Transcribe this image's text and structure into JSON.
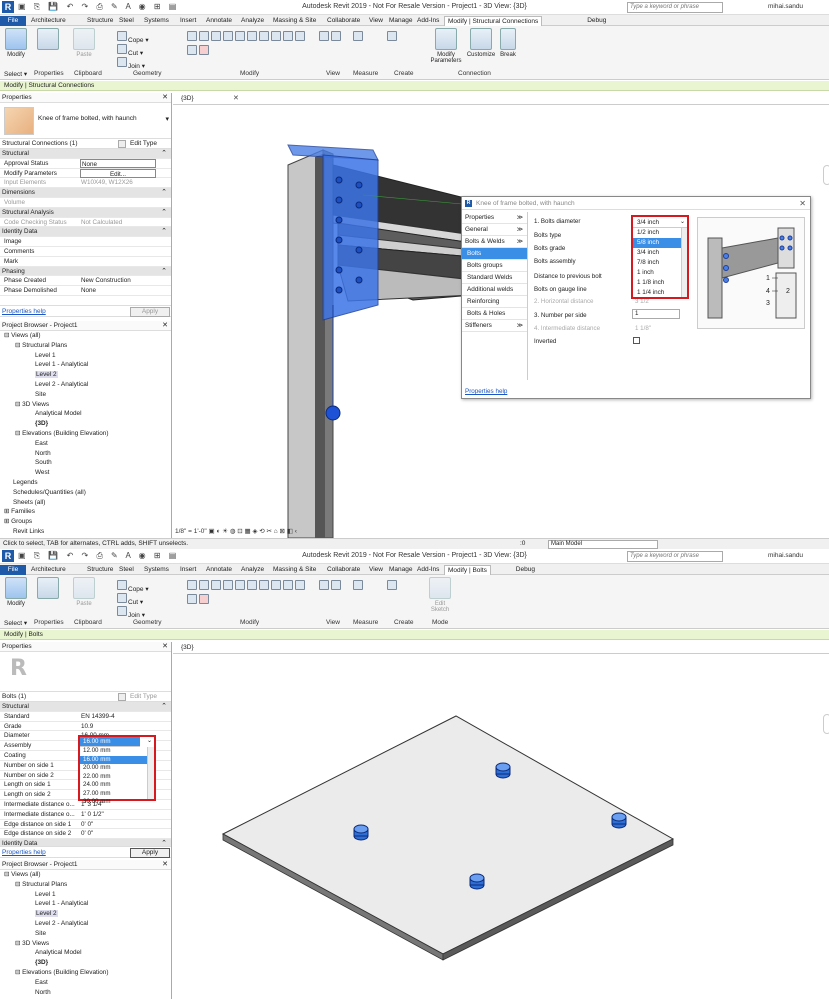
{
  "top": {
    "window_title": "Autodesk Revit 2019 - Not For Resale Version - Project1 - 3D View: {3D}",
    "search_placeholder": "Type a keyword or phrase",
    "user": "mihai.sandu",
    "tabs": [
      "File",
      "Architecture",
      "Structure",
      "Steel",
      "Systems",
      "Insert",
      "Annotate",
      "Analyze",
      "Massing & Site",
      "Collaborate",
      "View",
      "Manage",
      "Add-Ins",
      "Modify | Structural Connections",
      "Debug"
    ],
    "ribbon": {
      "modify": "Modify",
      "select": "Select ▾",
      "properties": "Properties",
      "clipboard": "Clipboard",
      "paste": "Paste",
      "cope": "Cope",
      "cut": "Cut",
      "join": "Join",
      "geometry": "Geometry",
      "modify_panel": "Modify",
      "view": "View",
      "measure": "Measure",
      "create": "Create",
      "modify_parameters": "Modify Parameters",
      "customize": "Customize",
      "break": "Break",
      "connection": "Connection"
    },
    "context": "Modify | Structural Connections",
    "properties_title": "Properties",
    "type_name": "Knee of frame bolted, with haunch",
    "filter": "Structural Connections (1)",
    "edit_type": "Edit Type",
    "properties": [
      {
        "k": "Structural",
        "v": "",
        "cat": true
      },
      {
        "k": "Approval Status",
        "v": "None"
      },
      {
        "k": "Modify Parameters",
        "v": "Edit..."
      },
      {
        "k": "Input Elements",
        "v": "W10X49, W12X26",
        "grey": true
      },
      {
        "k": "Dimensions",
        "v": "",
        "cat": true
      },
      {
        "k": "Volume",
        "v": "",
        "grey": true
      },
      {
        "k": "Structural Analysis",
        "v": "",
        "cat": true
      },
      {
        "k": "Code Checking Status",
        "v": "Not Calculated",
        "grey": true
      },
      {
        "k": "Identity Data",
        "v": "",
        "cat": true
      },
      {
        "k": "Image",
        "v": ""
      },
      {
        "k": "Comments",
        "v": ""
      },
      {
        "k": "Mark",
        "v": ""
      },
      {
        "k": "Phasing",
        "v": "",
        "cat": true
      },
      {
        "k": "Phase Created",
        "v": "New Construction"
      },
      {
        "k": "Phase Demolished",
        "v": "None"
      }
    ],
    "properties_help": "Properties help",
    "apply": "Apply",
    "browser_title": "Project Browser - Project1",
    "browser": [
      {
        "t": "Views (all)",
        "d": 0,
        "e": "⊟"
      },
      {
        "t": "Structural Plans",
        "d": 1,
        "e": "⊟"
      },
      {
        "t": "Level 1",
        "d": 2
      },
      {
        "t": "Level 1 - Analytical",
        "d": 2
      },
      {
        "t": "Level 2",
        "d": 2,
        "sel": true
      },
      {
        "t": "Level 2 - Analytical",
        "d": 2
      },
      {
        "t": "Site",
        "d": 2
      },
      {
        "t": "3D Views",
        "d": 1,
        "e": "⊟"
      },
      {
        "t": "Analytical Model",
        "d": 2
      },
      {
        "t": "{3D}",
        "d": 2,
        "bold": true
      },
      {
        "t": "Elevations (Building Elevation)",
        "d": 1,
        "e": "⊟"
      },
      {
        "t": "East",
        "d": 2
      },
      {
        "t": "North",
        "d": 2
      },
      {
        "t": "South",
        "d": 2
      },
      {
        "t": "West",
        "d": 2
      },
      {
        "t": "Legends",
        "d": 0
      },
      {
        "t": "Schedules/Quantities (all)",
        "d": 0
      },
      {
        "t": "Sheets (all)",
        "d": 0
      },
      {
        "t": "Families",
        "d": 0,
        "e": "⊞"
      },
      {
        "t": "Groups",
        "d": 0,
        "e": "⊞"
      },
      {
        "t": "Revit Links",
        "d": 0
      }
    ],
    "view_tab": "{3D}",
    "scale": "1/8\" = 1'-0\"",
    "dialog": {
      "title": "Knee of frame bolted, with haunch",
      "nav": [
        {
          "t": "Properties",
          "hdr": true
        },
        {
          "t": "General",
          "hdr": true
        },
        {
          "t": "Bolts & Welds",
          "hdr": true
        },
        {
          "t": "Bolts",
          "sel": true
        },
        {
          "t": "Bolts groups"
        },
        {
          "t": "Standard Welds"
        },
        {
          "t": "Additional welds"
        },
        {
          "t": "Reinforcing"
        },
        {
          "t": "Bolts & Holes"
        },
        {
          "t": "Stiffeners",
          "hdr": true
        }
      ],
      "fields": {
        "diameter": "1. Bolts diameter",
        "type": "Bolts type",
        "grade": "Bolts grade",
        "assembly": "Bolts assembly",
        "dist_prev": "Distance to previous bolt",
        "gauge": "Bolts on gauge line",
        "hdist": "2. Horizontal distance",
        "hdist_v": "3 1/2",
        "nper": "3. Number per side",
        "nper_v": "1",
        "idist": "4. Intermediate distance",
        "idist_v": "1 1/8\"",
        "inverted": "Inverted"
      },
      "diam_selected": "3/4 inch",
      "diam_options": [
        "1/2 inch",
        "5/8 inch",
        "3/4 inch",
        "7/8 inch",
        "1 inch",
        "1 1/8 inch",
        "1 1/4 inch"
      ],
      "diam_highlight": "5/8 inch",
      "help": "Properties help"
    }
  },
  "status": {
    "text": "Click to select, TAB for alternates, CTRL adds, SHIFT unselects.",
    "zero": ":0",
    "model": "Main Model"
  },
  "bottom": {
    "window_title": "Autodesk Revit 2019 - Not For Resale Version - Project1 - 3D View: {3D}",
    "search_placeholder": "Type a keyword or phrase",
    "user": "mihai.sandu",
    "tabs": [
      "File",
      "Architecture",
      "Structure",
      "Steel",
      "Systems",
      "Insert",
      "Annotate",
      "Analyze",
      "Massing & Site",
      "Collaborate",
      "View",
      "Manage",
      "Add-Ins",
      "Modify | Bolts",
      "Debug"
    ],
    "ribbon": {
      "modify": "Modify",
      "select": "Select ▾",
      "properties": "Properties",
      "clipboard": "Clipboard",
      "paste": "Paste",
      "cope": "Cope",
      "cut": "Cut",
      "join": "Join",
      "geometry": "Geometry",
      "modify_panel": "Modify",
      "view": "View",
      "measure": "Measure",
      "create": "Create",
      "edit_sketch": "Edit Sketch",
      "mode": "Mode"
    },
    "context": "Modify | Bolts",
    "properties_title": "Properties",
    "filter": "Bolts (1)",
    "edit_type": "Edit Type",
    "properties": [
      {
        "k": "Structural",
        "v": "",
        "cat": true
      },
      {
        "k": "Standard",
        "v": "EN 14399-4"
      },
      {
        "k": "Grade",
        "v": "10.9"
      },
      {
        "k": "Diameter",
        "v": "16.00 mm"
      },
      {
        "k": "Assembly",
        "v": ""
      },
      {
        "k": "Coating",
        "v": ""
      },
      {
        "k": "Number on side 1",
        "v": ""
      },
      {
        "k": "Number on side 2",
        "v": ""
      },
      {
        "k": "Length on side 1",
        "v": ""
      },
      {
        "k": "Length on side 2",
        "v": ""
      },
      {
        "k": "Intermediate distance o...",
        "v": "1'  3 1/4\""
      },
      {
        "k": "Intermediate distance o...",
        "v": "1'  0 1/2\""
      },
      {
        "k": "Edge distance on side 1",
        "v": "0'  0\""
      },
      {
        "k": "Edge distance on side 2",
        "v": "0'  0\""
      },
      {
        "k": "Identity Data",
        "v": "",
        "cat": true
      }
    ],
    "diam_selected": "16.00 mm",
    "diam_options": [
      "12.00 mm",
      "16.00 mm",
      "20.00 mm",
      "22.00 mm",
      "24.00 mm",
      "27.00 mm",
      "30.00 mm"
    ],
    "diam_highlight": "16.00 mm",
    "properties_help": "Properties help",
    "apply": "Apply",
    "browser_title": "Project Browser - Project1",
    "browser": [
      {
        "t": "Views (all)",
        "d": 0,
        "e": "⊟"
      },
      {
        "t": "Structural Plans",
        "d": 1,
        "e": "⊟"
      },
      {
        "t": "Level 1",
        "d": 2
      },
      {
        "t": "Level 1 - Analytical",
        "d": 2
      },
      {
        "t": "Level 2",
        "d": 2,
        "sel": true
      },
      {
        "t": "Level 2 - Analytical",
        "d": 2
      },
      {
        "t": "Site",
        "d": 2
      },
      {
        "t": "3D Views",
        "d": 1,
        "e": "⊟"
      },
      {
        "t": "Analytical Model",
        "d": 2
      },
      {
        "t": "{3D}",
        "d": 2,
        "bold": true
      },
      {
        "t": "Elevations (Building Elevation)",
        "d": 1,
        "e": "⊟"
      },
      {
        "t": "East",
        "d": 2
      },
      {
        "t": "North",
        "d": 2
      }
    ],
    "view_tab": "{3D}"
  },
  "colors": {
    "accent": "#1f5aa8",
    "selection": "#3a8ee6",
    "highlight_box": "#d6191e",
    "context_bar": "#e9f5d0",
    "bolt_blue": "#2e6fd6"
  }
}
